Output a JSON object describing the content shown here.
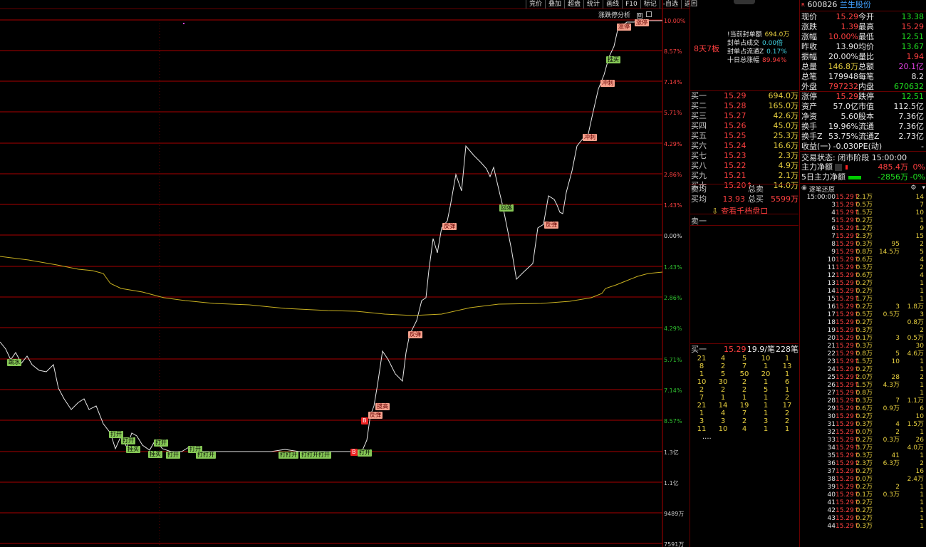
{
  "toolbar": [
    "竞价",
    "叠加",
    "超盘",
    "统计",
    "画线",
    "F10",
    "标记",
    "-自选",
    "返回"
  ],
  "chart": {
    "analysis_label": "涨跌停分析",
    "right_axis": [
      "10.00%",
      "8.57%",
      "7.14%",
      "5.71%",
      "4.29%",
      "2.86%",
      "1.43%",
      "0.00%",
      "1.43%",
      "2.86%",
      "4.29%",
      "5.71%",
      "7.14%",
      "8.57%",
      "1.3亿",
      "1.1亿",
      "9489万",
      "7591万"
    ],
    "tags": [
      {
        "t": "跳水",
        "c": "g"
      },
      {
        "t": "打开",
        "c": "g"
      },
      {
        "t": "打开",
        "c": "g"
      },
      {
        "t": "挂买",
        "c": "g"
      },
      {
        "t": "挂买",
        "c": "g"
      },
      {
        "t": "打开",
        "c": "g"
      },
      {
        "t": "打开",
        "c": "g"
      },
      {
        "t": "打开",
        "c": "g"
      },
      {
        "t": "打打开",
        "c": "g"
      },
      {
        "t": "打打开",
        "c": "g"
      },
      {
        "t": "打打开打开",
        "c": "g"
      },
      {
        "t": "B",
        "c": "b"
      },
      {
        "t": "打开",
        "c": "g"
      },
      {
        "t": "B",
        "c": "b"
      },
      {
        "t": "反弹",
        "c": "r"
      },
      {
        "t": "拔高",
        "c": "r"
      },
      {
        "t": "反弹",
        "c": "r"
      },
      {
        "t": "反弹",
        "c": "r"
      },
      {
        "t": "回落",
        "c": "g"
      },
      {
        "t": "反弹",
        "c": "r"
      },
      {
        "t": "冲刺",
        "c": "r"
      },
      {
        "t": "冲刺",
        "c": "r"
      },
      {
        "t": "挂买",
        "c": "g"
      },
      {
        "t": "涨停",
        "c": "r"
      },
      {
        "t": "涨停",
        "c": "r"
      }
    ]
  },
  "mid": {
    "board": "8天7板",
    "seal_info": [
      {
        "label": "!当前封单额",
        "value": "694.0万"
      },
      {
        "label": "封单占成交",
        "value": "0.00倍"
      },
      {
        "label": "封单占流通Z",
        "value": "0.17%"
      },
      {
        "label": "十日总涨幅",
        "value": "89.94%"
      }
    ],
    "buy": [
      {
        "n": "买一",
        "p": "15.29",
        "v": "694.0万"
      },
      {
        "n": "买二",
        "p": "15.28",
        "v": "165.0万"
      },
      {
        "n": "买三",
        "p": "15.27",
        "v": "42.6万"
      },
      {
        "n": "买四",
        "p": "15.26",
        "v": "45.0万"
      },
      {
        "n": "买五",
        "p": "15.25",
        "v": "25.3万"
      },
      {
        "n": "买六",
        "p": "15.24",
        "v": "16.6万"
      },
      {
        "n": "买七",
        "p": "15.23",
        "v": "2.3万"
      },
      {
        "n": "买八",
        "p": "15.22",
        "v": "4.9万"
      },
      {
        "n": "买九",
        "p": "15.21",
        "v": "2.1万"
      },
      {
        "n": "买十",
        "p": "15.20↑",
        "v": "14.0万"
      }
    ],
    "avg_sell_label": "卖均",
    "total_sell_label": "总卖",
    "avg_buy_label": "买均",
    "avg_buy": "13.93",
    "total_buy_label": "总买",
    "total_buy": "5599万",
    "qiandang": "查看千档盘口",
    "sell1": "卖一",
    "queue_head": {
      "label": "买一",
      "price": "15.29",
      "per": "19.9/笔",
      "count": "228笔"
    },
    "queue": [
      [
        "21",
        "4",
        "5",
        "10",
        "1"
      ],
      [
        "8",
        "2",
        "7",
        "1",
        "13"
      ],
      [
        "1",
        "5",
        "50",
        "20",
        "1"
      ],
      [
        "10",
        "30",
        "2",
        "1",
        "6"
      ],
      [
        "2",
        "2",
        "2",
        "5",
        "1"
      ],
      [
        "7",
        "1",
        "1",
        "1",
        "2"
      ],
      [
        "21",
        "14",
        "19",
        "1",
        "17"
      ],
      [
        "1",
        "4",
        "7",
        "1",
        "2"
      ],
      [
        "3",
        "3",
        "2",
        "3",
        "2"
      ],
      [
        "11",
        "10",
        "4",
        "1",
        "1"
      ]
    ],
    "queue_more": "...."
  },
  "right": {
    "code": "600826",
    "name": "兰生股份",
    "quote": [
      [
        {
          "l": "现价",
          "v": "15.29",
          "c": "red"
        },
        {
          "l": "今开",
          "v": "13.38",
          "c": "grn"
        }
      ],
      [
        {
          "l": "涨跌",
          "v": "1.39",
          "c": "red"
        },
        {
          "l": "最高",
          "v": "15.29",
          "c": "red"
        }
      ],
      [
        {
          "l": "涨幅",
          "v": "10.00%",
          "c": "red"
        },
        {
          "l": "最低",
          "v": "12.51",
          "c": "grn"
        }
      ],
      [
        {
          "l": "昨收",
          "v": "13.90",
          "c": "wht"
        },
        {
          "l": "均价",
          "v": "13.67",
          "c": "grn"
        }
      ],
      [
        {
          "l": "振幅",
          "v": "20.00%",
          "c": "wht"
        },
        {
          "l": "量比",
          "v": "1.94",
          "c": "red"
        }
      ],
      [
        {
          "l": "总量",
          "v": "146.8万",
          "c": "yel"
        },
        {
          "l": "总额",
          "v": "20.1亿",
          "c": "mag"
        }
      ],
      [
        {
          "l": "总笔",
          "v": "179948",
          "c": "wht"
        },
        {
          "l": "每笔",
          "v": "8.2",
          "c": "wht"
        }
      ],
      [
        {
          "l": "外盘",
          "v": "797232",
          "c": "red"
        },
        {
          "l": "内盘",
          "v": "670632",
          "c": "grn"
        }
      ]
    ],
    "stats": [
      [
        {
          "l": "涨停",
          "v": "15.29",
          "c": "red"
        },
        {
          "l": "跌停",
          "v": "12.51",
          "c": "grn"
        }
      ],
      [
        {
          "l": "资产",
          "v": "57.0亿",
          "c": "wht"
        },
        {
          "l": "市值",
          "v": "112.5亿",
          "c": "wht"
        }
      ],
      [
        {
          "l": "净资",
          "v": "5.60",
          "c": "wht"
        },
        {
          "l": "股本",
          "v": "7.36亿",
          "c": "wht"
        }
      ],
      [
        {
          "l": "换手",
          "v": "19.96%",
          "c": "wht"
        },
        {
          "l": "流通",
          "v": "7.36亿",
          "c": "wht"
        }
      ],
      [
        {
          "l": "换手Z",
          "v": "53.75%",
          "c": "wht"
        },
        {
          "l": "流通Z",
          "v": "2.73亿",
          "c": "wht"
        }
      ],
      [
        {
          "l": "收益(一)",
          "v": "-0.030",
          "c": "wht"
        },
        {
          "l": "PE(动)",
          "v": "-",
          "c": "wht"
        }
      ]
    ],
    "trade_state": "交易状态: 闭市阶段 15:00:00",
    "main_net": {
      "label": "主力净额",
      "v": "485.4万",
      "p": "0%"
    },
    "main_net5": {
      "label": "5日主力净额",
      "v": "-2856万",
      "p": "-0%"
    },
    "zhubi_title": "逐笔还原",
    "ticks": [
      [
        "15:00:00",
        "15.29↑",
        "2.1万",
        "",
        "14"
      ],
      [
        "3",
        "15.29↑",
        "0.5万",
        "",
        "7"
      ],
      [
        "4",
        "15.29↑",
        "1.5万",
        "",
        "10"
      ],
      [
        "5",
        "15.29↑",
        "0.2万",
        "",
        "1"
      ],
      [
        "6",
        "15.29↑",
        "1.2万",
        "",
        "9"
      ],
      [
        "7",
        "15.29↑",
        "2.3万",
        "",
        "15"
      ],
      [
        "8",
        "15.29↑",
        "0.3万",
        "95",
        "2"
      ],
      [
        "9",
        "15.29↑",
        "0.8万",
        "14.5万",
        "5"
      ],
      [
        "10",
        "15.29↑",
        "0.6万",
        "",
        "4"
      ],
      [
        "11",
        "15.29↑",
        "0.3万",
        "",
        "2"
      ],
      [
        "12",
        "15.29↑",
        "0.6万",
        "",
        "4"
      ],
      [
        "13",
        "15.29↑",
        "0.2万",
        "",
        "1"
      ],
      [
        "14",
        "15.29↑",
        "0.2万",
        "",
        "1"
      ],
      [
        "15",
        "15.29↑",
        "1.7万",
        "",
        "1"
      ],
      [
        "16",
        "15.29↑",
        "0.2万",
        "3",
        "1.8万"
      ],
      [
        "17",
        "15.29↑",
        "0.5万",
        "0.5万",
        "3"
      ],
      [
        "18",
        "15.29↑",
        "0.2万",
        "",
        "0.8万"
      ],
      [
        "19",
        "15.29↑",
        "0.3万",
        "",
        "2"
      ],
      [
        "20",
        "15.29↑",
        "0.1万",
        "3",
        "0.5万"
      ],
      [
        "21",
        "15.29↑",
        "0.3万",
        "",
        "30"
      ],
      [
        "22",
        "15.29↑",
        "0.8万",
        "5",
        "4.6万"
      ],
      [
        "23",
        "15.29↑",
        "1.5万",
        "10",
        "1"
      ],
      [
        "24",
        "15.29↑",
        "0.2万",
        "",
        "1"
      ],
      [
        "25",
        "15.29↑",
        "2.0万",
        "28",
        "2"
      ],
      [
        "26",
        "15.29↑",
        "1.5万",
        "4.3万",
        "1"
      ],
      [
        "27",
        "15.29↑",
        "0.8万",
        "",
        "1"
      ],
      [
        "28",
        "15.29↑",
        "0.3万",
        "7",
        "1.1万"
      ],
      [
        "29",
        "15.29↑",
        "0.6万",
        "0.9万",
        "6"
      ],
      [
        "30",
        "15.29↑",
        "0.2万",
        "",
        "10"
      ],
      [
        "31",
        "15.29↑",
        "0.3万",
        "4",
        "1.5万"
      ],
      [
        "32",
        "15.29↑",
        "0.0万",
        "2",
        "1"
      ],
      [
        "33",
        "15.29↑",
        "0.2万",
        "0.3万",
        "26"
      ],
      [
        "34",
        "15.29↑",
        "3.7万",
        "",
        "4.0万"
      ],
      [
        "35",
        "15.29↑",
        "0.3万",
        "41",
        "1"
      ],
      [
        "36",
        "15.29↑",
        "2.3万",
        "6.3万",
        "2"
      ],
      [
        "37",
        "15.29↑",
        "0.2万",
        "",
        "16"
      ],
      [
        "38",
        "15.29↑",
        "0.0万",
        "",
        "2.4万"
      ],
      [
        "39",
        "15.29↑",
        "0.2万",
        "2",
        "1"
      ],
      [
        "40",
        "15.29↑",
        "0.1万",
        "0.3万",
        "1"
      ],
      [
        "41",
        "15.29↑",
        "0.2万",
        "",
        "1"
      ],
      [
        "42",
        "15.29↑",
        "0.2万",
        "",
        "1"
      ],
      [
        "43",
        "15.29↑",
        "0.2万",
        "",
        "1"
      ],
      [
        "44",
        "15.29↑",
        "0.3万",
        "",
        "1"
      ]
    ]
  }
}
